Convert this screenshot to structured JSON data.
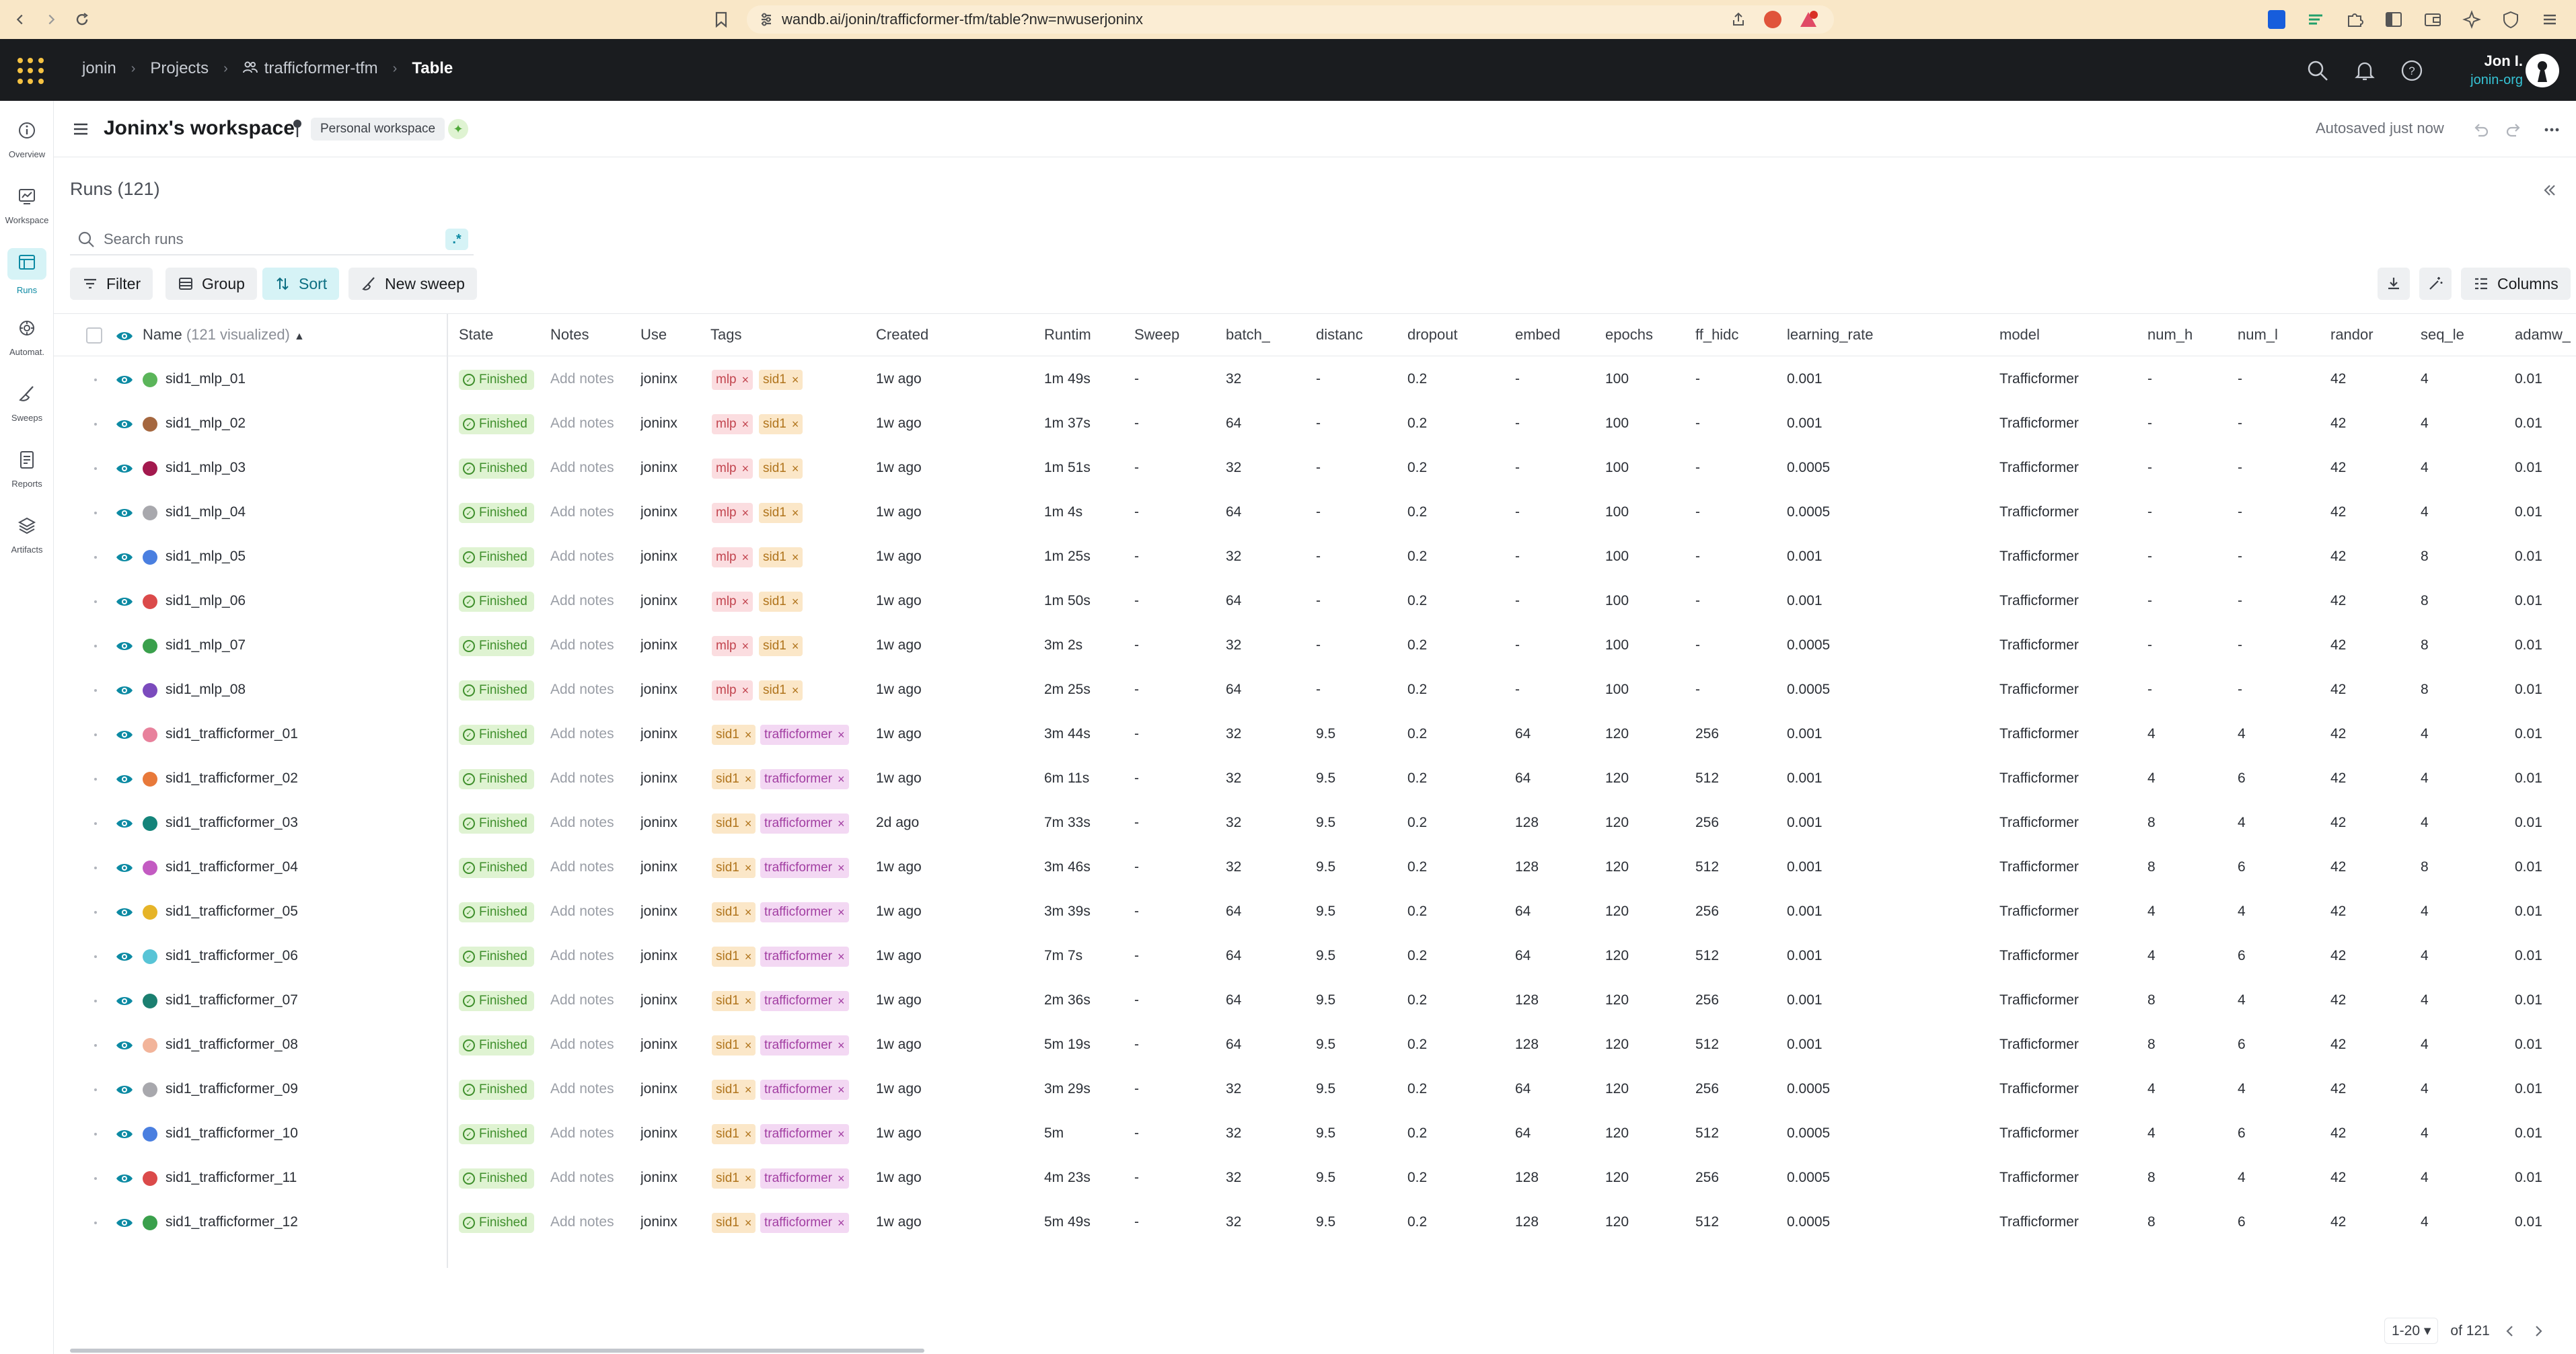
{
  "browser": {
    "url": "wandb.ai/jonin/trafficformer-tfm/table?nw=nwuserjoninx"
  },
  "header": {
    "breadcrumbs": [
      "jonin",
      "Projects",
      "trafficformer-tfm",
      "Table"
    ],
    "user_name": "Jon I.",
    "user_org": "jonin-org"
  },
  "nav": {
    "items": [
      {
        "label": "Overview",
        "icon": "info-icon"
      },
      {
        "label": "Workspace",
        "icon": "workspace-icon"
      },
      {
        "label": "Runs",
        "icon": "table-icon",
        "active": true
      },
      {
        "label": "Automat.",
        "icon": "automation-icon"
      },
      {
        "label": "Sweeps",
        "icon": "sweep-icon"
      },
      {
        "label": "Reports",
        "icon": "report-icon"
      },
      {
        "label": "Artifacts",
        "icon": "layers-icon"
      }
    ]
  },
  "workspace": {
    "title": "Joninx's workspace",
    "badge": "Personal workspace",
    "autosave": "Autosaved just now"
  },
  "runs_panel": {
    "title": "Runs (121)",
    "search_placeholder": "Search runs",
    "regex_label": ".*",
    "filter_label": "Filter",
    "group_label": "Group",
    "sort_label": "Sort",
    "new_sweep_label": "New sweep",
    "columns_label": "Columns"
  },
  "table": {
    "name_header": "Name",
    "name_header_note": "(121 visualized)",
    "columns": [
      "State",
      "Notes",
      "Use",
      "Tags",
      "Created",
      "Runtim",
      "Sweep",
      "batch_",
      "distanc",
      "dropout",
      "embed",
      "epochs",
      "ff_hidc",
      "learning_rate",
      "model",
      "num_h",
      "num_l",
      "randor",
      "seq_le",
      "adamw_"
    ],
    "state_label": "Finished",
    "notes_label": "Add notes",
    "rows": [
      {
        "name": "sid1_mlp_01",
        "color": "#5bb55a",
        "tags": [
          "mlp",
          "sid1"
        ],
        "user": "joninx",
        "created": "1w ago",
        "runtime": "1m 49s",
        "sweep": "-",
        "batch": "32",
        "distance": "-",
        "dropout": "0.2",
        "embed": "-",
        "epochs": "100",
        "ff_hidden": "-",
        "lr": "0.001",
        "model": "Trafficformer",
        "num_h": "-",
        "num_l": "-",
        "random": "42",
        "seq_len": "4",
        "adamw": "0.01"
      },
      {
        "name": "sid1_mlp_02",
        "color": "#a5673f",
        "tags": [
          "mlp",
          "sid1"
        ],
        "user": "joninx",
        "created": "1w ago",
        "runtime": "1m 37s",
        "sweep": "-",
        "batch": "64",
        "distance": "-",
        "dropout": "0.2",
        "embed": "-",
        "epochs": "100",
        "ff_hidden": "-",
        "lr": "0.001",
        "model": "Trafficformer",
        "num_h": "-",
        "num_l": "-",
        "random": "42",
        "seq_len": "4",
        "adamw": "0.01"
      },
      {
        "name": "sid1_mlp_03",
        "color": "#a3194e",
        "tags": [
          "mlp",
          "sid1"
        ],
        "user": "joninx",
        "created": "1w ago",
        "runtime": "1m 51s",
        "sweep": "-",
        "batch": "32",
        "distance": "-",
        "dropout": "0.2",
        "embed": "-",
        "epochs": "100",
        "ff_hidden": "-",
        "lr": "0.0005",
        "model": "Trafficformer",
        "num_h": "-",
        "num_l": "-",
        "random": "42",
        "seq_len": "4",
        "adamw": "0.01"
      },
      {
        "name": "sid1_mlp_04",
        "color": "#a8a8ad",
        "tags": [
          "mlp",
          "sid1"
        ],
        "user": "joninx",
        "created": "1w ago",
        "runtime": "1m 4s",
        "sweep": "-",
        "batch": "64",
        "distance": "-",
        "dropout": "0.2",
        "embed": "-",
        "epochs": "100",
        "ff_hidden": "-",
        "lr": "0.0005",
        "model": "Trafficformer",
        "num_h": "-",
        "num_l": "-",
        "random": "42",
        "seq_len": "4",
        "adamw": "0.01"
      },
      {
        "name": "sid1_mlp_05",
        "color": "#4a7fe0",
        "tags": [
          "mlp",
          "sid1"
        ],
        "user": "joninx",
        "created": "1w ago",
        "runtime": "1m 25s",
        "sweep": "-",
        "batch": "32",
        "distance": "-",
        "dropout": "0.2",
        "embed": "-",
        "epochs": "100",
        "ff_hidden": "-",
        "lr": "0.001",
        "model": "Trafficformer",
        "num_h": "-",
        "num_l": "-",
        "random": "42",
        "seq_len": "8",
        "adamw": "0.01"
      },
      {
        "name": "sid1_mlp_06",
        "color": "#db4a4a",
        "tags": [
          "mlp",
          "sid1"
        ],
        "user": "joninx",
        "created": "1w ago",
        "runtime": "1m 50s",
        "sweep": "-",
        "batch": "64",
        "distance": "-",
        "dropout": "0.2",
        "embed": "-",
        "epochs": "100",
        "ff_hidden": "-",
        "lr": "0.001",
        "model": "Trafficformer",
        "num_h": "-",
        "num_l": "-",
        "random": "42",
        "seq_len": "8",
        "adamw": "0.01"
      },
      {
        "name": "sid1_mlp_07",
        "color": "#3aa04c",
        "tags": [
          "mlp",
          "sid1"
        ],
        "user": "joninx",
        "created": "1w ago",
        "runtime": "3m 2s",
        "sweep": "-",
        "batch": "32",
        "distance": "-",
        "dropout": "0.2",
        "embed": "-",
        "epochs": "100",
        "ff_hidden": "-",
        "lr": "0.0005",
        "model": "Trafficformer",
        "num_h": "-",
        "num_l": "-",
        "random": "42",
        "seq_len": "8",
        "adamw": "0.01"
      },
      {
        "name": "sid1_mlp_08",
        "color": "#7b4bbd",
        "tags": [
          "mlp",
          "sid1"
        ],
        "user": "joninx",
        "created": "1w ago",
        "runtime": "2m 25s",
        "sweep": "-",
        "batch": "64",
        "distance": "-",
        "dropout": "0.2",
        "embed": "-",
        "epochs": "100",
        "ff_hidden": "-",
        "lr": "0.0005",
        "model": "Trafficformer",
        "num_h": "-",
        "num_l": "-",
        "random": "42",
        "seq_len": "8",
        "adamw": "0.01"
      },
      {
        "name": "sid1_trafficformer_01",
        "color": "#e8819c",
        "tags": [
          "sid1",
          "trafficformer"
        ],
        "user": "joninx",
        "created": "1w ago",
        "runtime": "3m 44s",
        "sweep": "-",
        "batch": "32",
        "distance": "9.5",
        "dropout": "0.2",
        "embed": "64",
        "epochs": "120",
        "ff_hidden": "256",
        "lr": "0.001",
        "model": "Trafficformer",
        "num_h": "4",
        "num_l": "4",
        "random": "42",
        "seq_len": "4",
        "adamw": "0.01"
      },
      {
        "name": "sid1_trafficformer_02",
        "color": "#e8793a",
        "tags": [
          "sid1",
          "trafficformer"
        ],
        "user": "joninx",
        "created": "1w ago",
        "runtime": "6m 11s",
        "sweep": "-",
        "batch": "32",
        "distance": "9.5",
        "dropout": "0.2",
        "embed": "64",
        "epochs": "120",
        "ff_hidden": "512",
        "lr": "0.001",
        "model": "Trafficformer",
        "num_h": "4",
        "num_l": "6",
        "random": "42",
        "seq_len": "4",
        "adamw": "0.01"
      },
      {
        "name": "sid1_trafficformer_03",
        "color": "#14847a",
        "tags": [
          "sid1",
          "trafficformer"
        ],
        "user": "joninx",
        "created": "2d ago",
        "runtime": "7m 33s",
        "sweep": "-",
        "batch": "32",
        "distance": "9.5",
        "dropout": "0.2",
        "embed": "128",
        "epochs": "120",
        "ff_hidden": "256",
        "lr": "0.001",
        "model": "Trafficformer",
        "num_h": "8",
        "num_l": "4",
        "random": "42",
        "seq_len": "4",
        "adamw": "0.01"
      },
      {
        "name": "sid1_trafficformer_04",
        "color": "#c35bc2",
        "tags": [
          "sid1",
          "trafficformer"
        ],
        "user": "joninx",
        "created": "1w ago",
        "runtime": "3m 46s",
        "sweep": "-",
        "batch": "32",
        "distance": "9.5",
        "dropout": "0.2",
        "embed": "128",
        "epochs": "120",
        "ff_hidden": "512",
        "lr": "0.001",
        "model": "Trafficformer",
        "num_h": "8",
        "num_l": "6",
        "random": "42",
        "seq_len": "8",
        "adamw": "0.01"
      },
      {
        "name": "sid1_trafficformer_05",
        "color": "#e6b428",
        "tags": [
          "sid1",
          "trafficformer"
        ],
        "user": "joninx",
        "created": "1w ago",
        "runtime": "3m 39s",
        "sweep": "-",
        "batch": "64",
        "distance": "9.5",
        "dropout": "0.2",
        "embed": "64",
        "epochs": "120",
        "ff_hidden": "256",
        "lr": "0.001",
        "model": "Trafficformer",
        "num_h": "4",
        "num_l": "4",
        "random": "42",
        "seq_len": "4",
        "adamw": "0.01"
      },
      {
        "name": "sid1_trafficformer_06",
        "color": "#58c4d6",
        "tags": [
          "sid1",
          "trafficformer"
        ],
        "user": "joninx",
        "created": "1w ago",
        "runtime": "7m 7s",
        "sweep": "-",
        "batch": "64",
        "distance": "9.5",
        "dropout": "0.2",
        "embed": "64",
        "epochs": "120",
        "ff_hidden": "512",
        "lr": "0.001",
        "model": "Trafficformer",
        "num_h": "4",
        "num_l": "6",
        "random": "42",
        "seq_len": "4",
        "adamw": "0.01"
      },
      {
        "name": "sid1_trafficformer_07",
        "color": "#1b7f70",
        "tags": [
          "sid1",
          "trafficformer"
        ],
        "user": "joninx",
        "created": "1w ago",
        "runtime": "2m 36s",
        "sweep": "-",
        "batch": "64",
        "distance": "9.5",
        "dropout": "0.2",
        "embed": "128",
        "epochs": "120",
        "ff_hidden": "256",
        "lr": "0.001",
        "model": "Trafficformer",
        "num_h": "8",
        "num_l": "4",
        "random": "42",
        "seq_len": "4",
        "adamw": "0.01"
      },
      {
        "name": "sid1_trafficformer_08",
        "color": "#f2b49a",
        "tags": [
          "sid1",
          "trafficformer"
        ],
        "user": "joninx",
        "created": "1w ago",
        "runtime": "5m 19s",
        "sweep": "-",
        "batch": "64",
        "distance": "9.5",
        "dropout": "0.2",
        "embed": "128",
        "epochs": "120",
        "ff_hidden": "512",
        "lr": "0.001",
        "model": "Trafficformer",
        "num_h": "8",
        "num_l": "6",
        "random": "42",
        "seq_len": "4",
        "adamw": "0.01"
      },
      {
        "name": "sid1_trafficformer_09",
        "color": "#a8a8ad",
        "tags": [
          "sid1",
          "trafficformer"
        ],
        "user": "joninx",
        "created": "1w ago",
        "runtime": "3m 29s",
        "sweep": "-",
        "batch": "32",
        "distance": "9.5",
        "dropout": "0.2",
        "embed": "64",
        "epochs": "120",
        "ff_hidden": "256",
        "lr": "0.0005",
        "model": "Trafficformer",
        "num_h": "4",
        "num_l": "4",
        "random": "42",
        "seq_len": "4",
        "adamw": "0.01"
      },
      {
        "name": "sid1_trafficformer_10",
        "color": "#4a7fe0",
        "tags": [
          "sid1",
          "trafficformer"
        ],
        "user": "joninx",
        "created": "1w ago",
        "runtime": "5m",
        "sweep": "-",
        "batch": "32",
        "distance": "9.5",
        "dropout": "0.2",
        "embed": "64",
        "epochs": "120",
        "ff_hidden": "512",
        "lr": "0.0005",
        "model": "Trafficformer",
        "num_h": "4",
        "num_l": "6",
        "random": "42",
        "seq_len": "4",
        "adamw": "0.01"
      },
      {
        "name": "sid1_trafficformer_11",
        "color": "#db4a4a",
        "tags": [
          "sid1",
          "trafficformer"
        ],
        "user": "joninx",
        "created": "1w ago",
        "runtime": "4m 23s",
        "sweep": "-",
        "batch": "32",
        "distance": "9.5",
        "dropout": "0.2",
        "embed": "128",
        "epochs": "120",
        "ff_hidden": "256",
        "lr": "0.0005",
        "model": "Trafficformer",
        "num_h": "8",
        "num_l": "4",
        "random": "42",
        "seq_len": "4",
        "adamw": "0.01"
      },
      {
        "name": "sid1_trafficformer_12",
        "color": "#3aa04c",
        "tags": [
          "sid1",
          "trafficformer"
        ],
        "user": "joninx",
        "created": "1w ago",
        "runtime": "5m 49s",
        "sweep": "-",
        "batch": "32",
        "distance": "9.5",
        "dropout": "0.2",
        "embed": "128",
        "epochs": "120",
        "ff_hidden": "512",
        "lr": "0.0005",
        "model": "Trafficformer",
        "num_h": "8",
        "num_l": "6",
        "random": "42",
        "seq_len": "4",
        "adamw": "0.01"
      }
    ]
  },
  "pager": {
    "page_size": "1-20",
    "total": "of 121"
  },
  "colors": {
    "accent": "#0c8aa3",
    "finished_green": "#3f8f2c",
    "header_bg": "#1a1c1f",
    "browser_bg": "#f9e7c7"
  }
}
